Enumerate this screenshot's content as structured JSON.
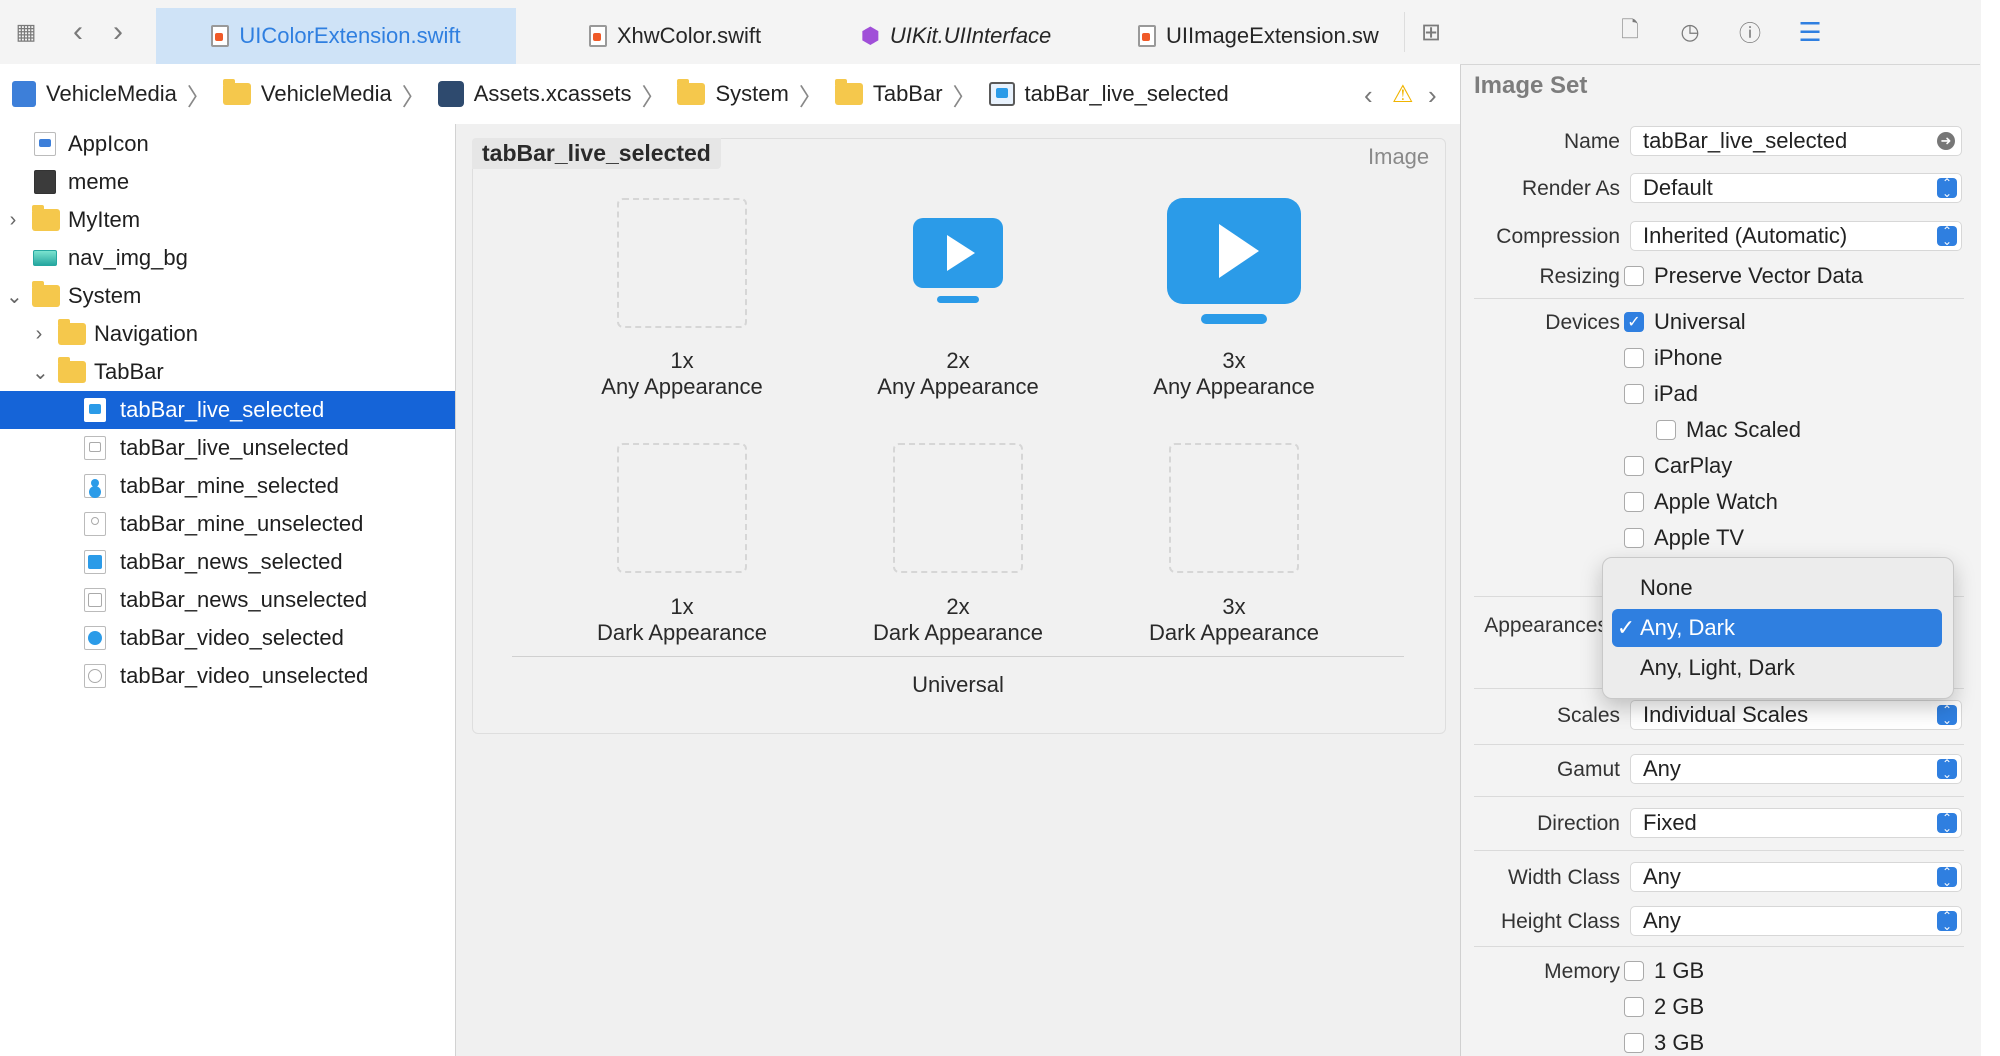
{
  "tabs": [
    {
      "label": "UIColorExtension.swift",
      "active": true
    },
    {
      "label": "XhwColor.swift",
      "active": false
    },
    {
      "label": "UIKit.UIInterface",
      "active": false
    },
    {
      "label": "UIImageExtension.sw",
      "active": false
    }
  ],
  "breadcrumb": [
    "VehicleMedia",
    "VehicleMedia",
    "Assets.xcassets",
    "System",
    "TabBar",
    "tabBar_live_selected"
  ],
  "sidebar": {
    "items": [
      {
        "label": "AppIcon"
      },
      {
        "label": "meme"
      },
      {
        "label": "MyItem"
      },
      {
        "label": "nav_img_bg"
      },
      {
        "label": "System"
      },
      {
        "label": "Navigation"
      },
      {
        "label": "TabBar"
      },
      {
        "label": "tabBar_live_selected"
      },
      {
        "label": "tabBar_live_unselected"
      },
      {
        "label": "tabBar_mine_selected"
      },
      {
        "label": "tabBar_mine_unselected"
      },
      {
        "label": "tabBar_news_selected"
      },
      {
        "label": "tabBar_news_unselected"
      },
      {
        "label": "tabBar_video_selected"
      },
      {
        "label": "tabBar_video_unselected"
      }
    ]
  },
  "editor": {
    "set_name": "tabBar_live_selected",
    "set_type": "Image",
    "slots": [
      {
        "scale": "1x",
        "appearance": "Any Appearance"
      },
      {
        "scale": "2x",
        "appearance": "Any Appearance"
      },
      {
        "scale": "3x",
        "appearance": "Any Appearance"
      },
      {
        "scale": "1x",
        "appearance": "Dark Appearance"
      },
      {
        "scale": "2x",
        "appearance": "Dark Appearance"
      },
      {
        "scale": "3x",
        "appearance": "Dark Appearance"
      }
    ],
    "group_label": "Universal",
    "accent_color": "#2b9be8"
  },
  "inspector": {
    "heading": "Image Set",
    "name_label": "Name",
    "name_value": "tabBar_live_selected",
    "render_as_label": "Render As",
    "render_as_value": "Default",
    "compression_label": "Compression",
    "compression_value": "Inherited (Automatic)",
    "resizing_label": "Resizing",
    "resizing_option": "Preserve Vector Data",
    "devices_label": "Devices",
    "devices": [
      {
        "label": "Universal",
        "checked": true
      },
      {
        "label": "iPhone",
        "checked": false
      },
      {
        "label": "iPad",
        "checked": false
      },
      {
        "label": "Mac Scaled",
        "checked": false
      },
      {
        "label": "CarPlay",
        "checked": false
      },
      {
        "label": "Apple Watch",
        "checked": false
      },
      {
        "label": "Apple TV",
        "checked": false
      }
    ],
    "appearances_label": "Appearances",
    "scales_label": "Scales",
    "scales_value": "Individual Scales",
    "gamut_label": "Gamut",
    "gamut_value": "Any",
    "direction_label": "Direction",
    "direction_value": "Fixed",
    "width_class_label": "Width Class",
    "width_class_value": "Any",
    "height_class_label": "Height Class",
    "height_class_value": "Any",
    "memory_label": "Memory",
    "memory": [
      "1 GB",
      "2 GB",
      "3 GB"
    ]
  },
  "popup": {
    "options": [
      "None",
      "Any, Dark",
      "Any, Light, Dark"
    ],
    "selected": "Any, Dark",
    "checkmark": "✓"
  }
}
